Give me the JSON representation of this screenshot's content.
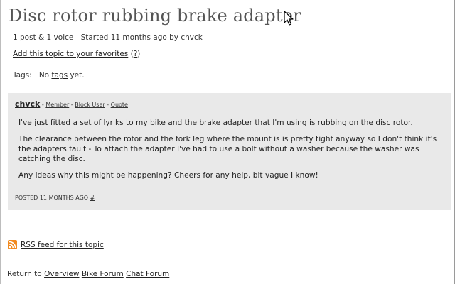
{
  "topic": {
    "title": "Disc rotor rubbing brake adapter",
    "meta": "1 post & 1 voice | Started 11 months ago by chvck",
    "favorites_link": "Add this topic to your favorites",
    "favorites_help_open": " (",
    "favorites_help": "?",
    "favorites_help_close": ")",
    "tags_label": "Tags:",
    "tags_prefix": "No ",
    "tags_link": "tags",
    "tags_suffix": " yet."
  },
  "post": {
    "author": "chvck",
    "sep1": " - ",
    "member": "Member",
    "sep2": " - ",
    "block_user": "Block User",
    "sep3": " - ",
    "quote": "Quote",
    "paragraphs": [
      "I've just fitted a set of lyriks to my bike and the brake adapter that I'm using is rubbing on the disc rotor.",
      "The clearance between the rotor and the fork leg where the mount is is pretty tight anyway so I don't think it's the adapters fault - To attach the adapter I've had to use a bolt without a washer because the washer was catching the disc.",
      "Any ideas why this might be happening? Cheers for any help, bit vague I know!"
    ],
    "posted": "POSTED 11 MONTHS AGO ",
    "permalink": "#"
  },
  "rss": {
    "label": "RSS feed for this topic"
  },
  "return_nav": {
    "prefix": "Return to ",
    "links": [
      "Overview",
      "Bike Forum",
      "Chat Forum"
    ]
  },
  "icons": {
    "cursor": "cursor-arrow-icon",
    "rss": "rss-feed-icon"
  },
  "colors": {
    "rss_orange": "#f28a1f",
    "post_bg": "#e9e9e9",
    "title_gray": "#555555"
  }
}
